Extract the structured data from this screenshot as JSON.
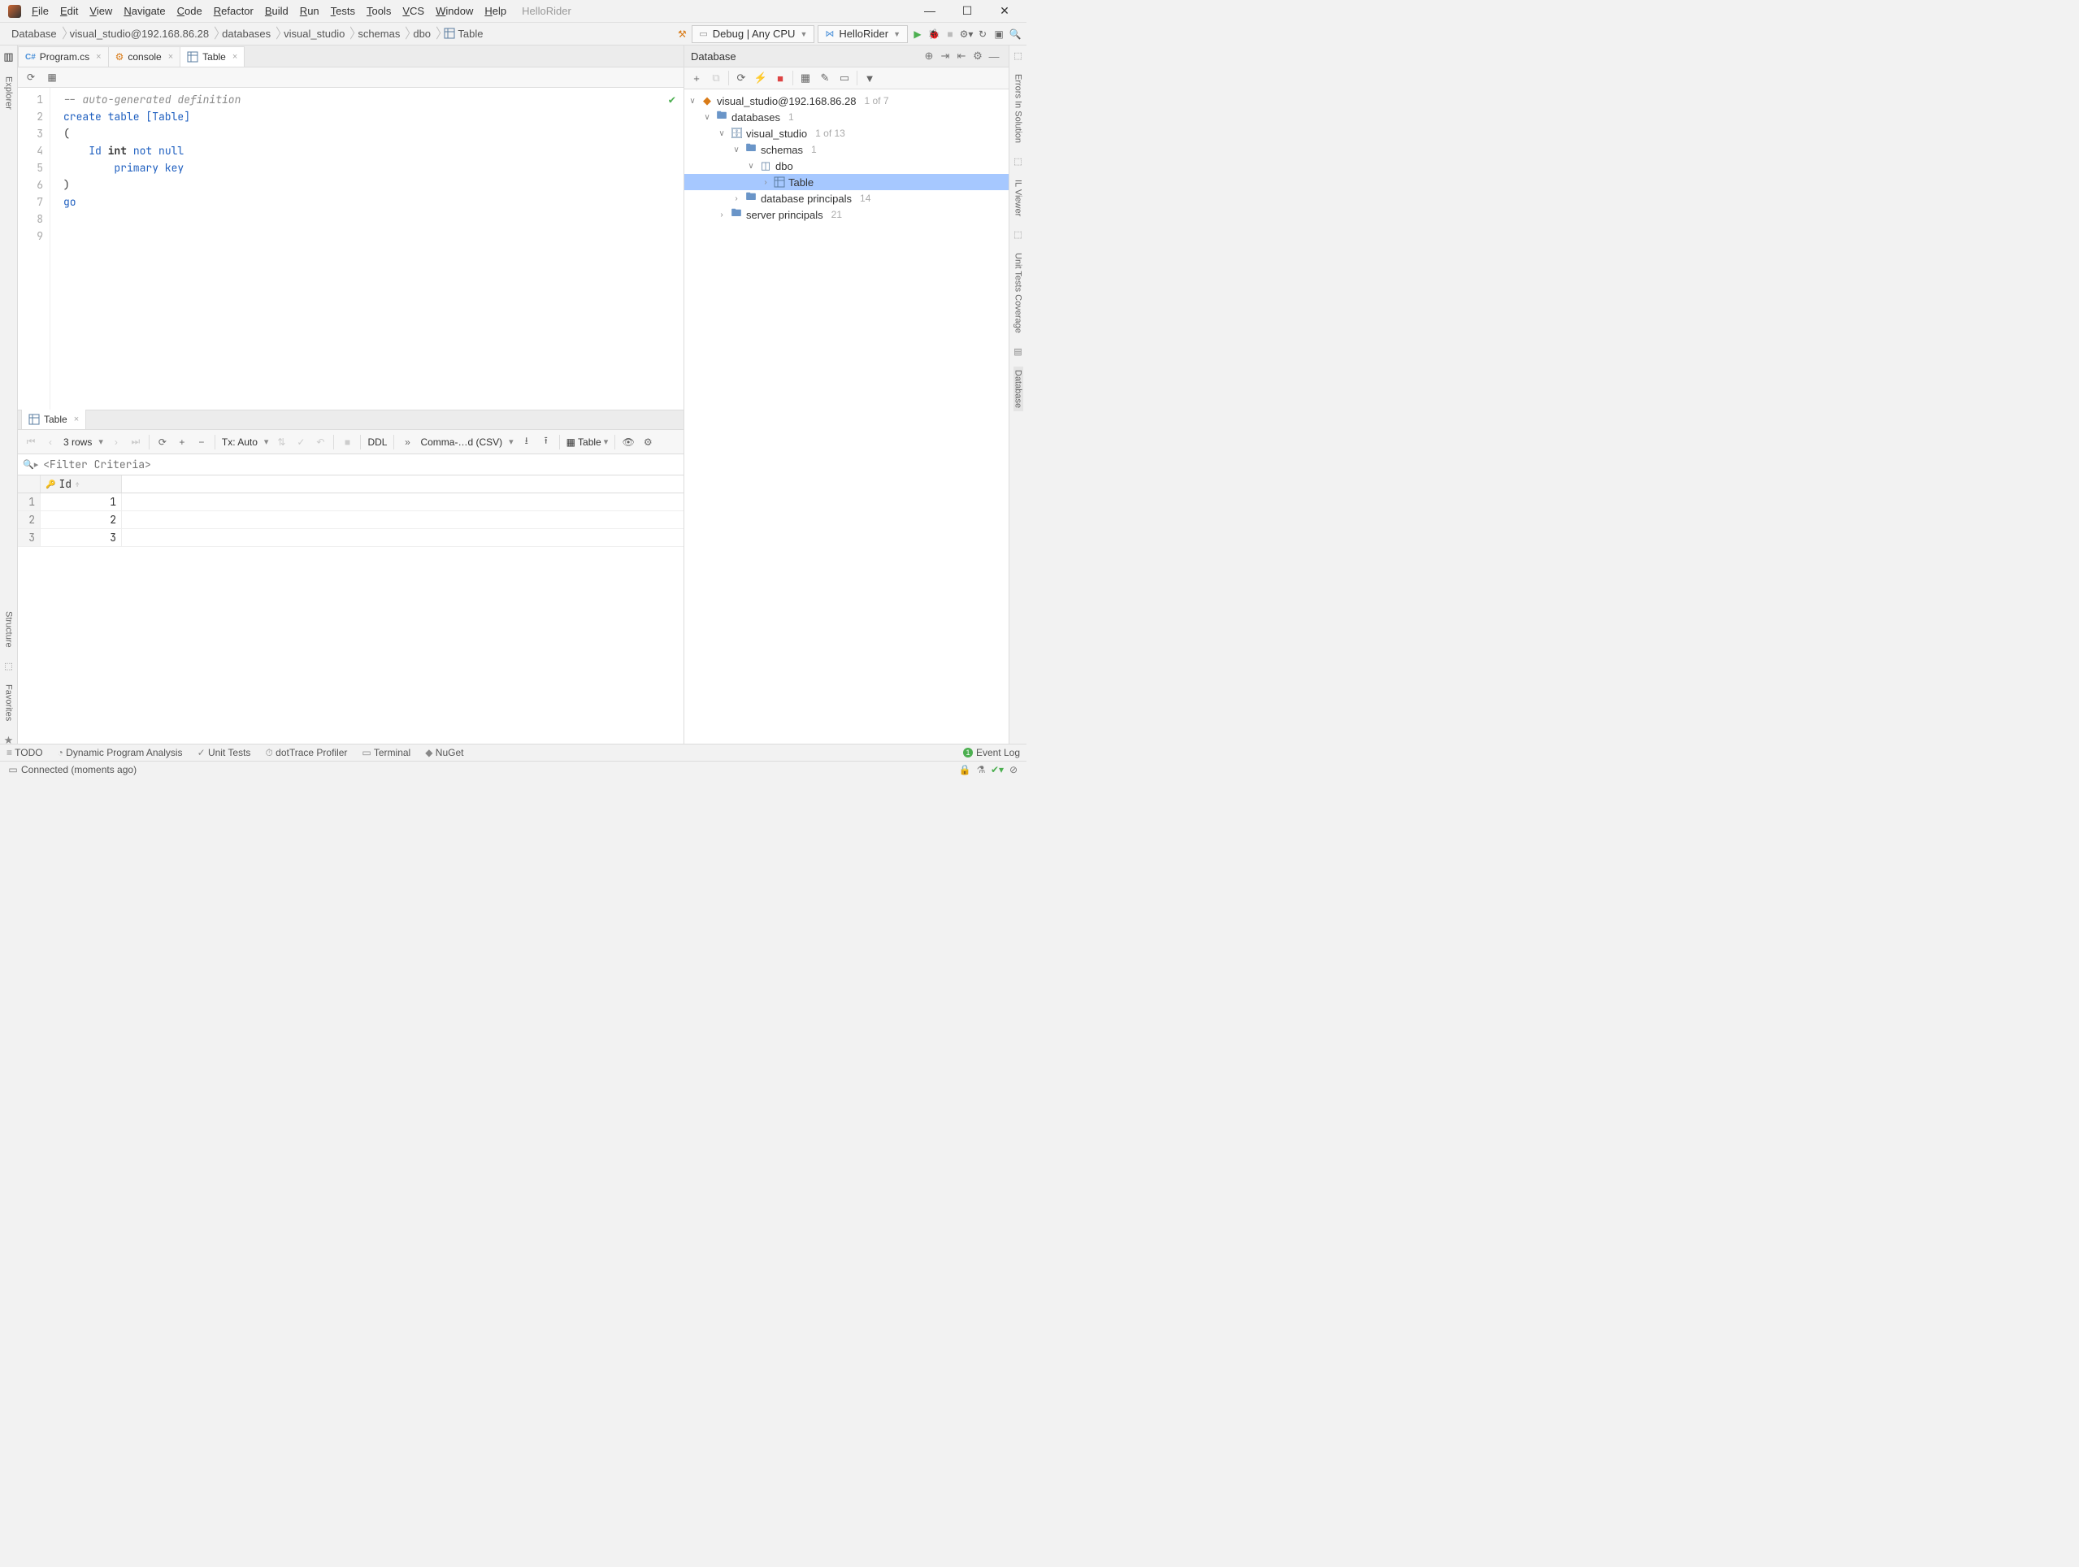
{
  "menu": {
    "items": [
      "File",
      "Edit",
      "View",
      "Navigate",
      "Code",
      "Refactor",
      "Build",
      "Run",
      "Tests",
      "Tools",
      "VCS",
      "Window",
      "Help"
    ],
    "project": "HelloRider"
  },
  "breadcrumb": [
    "Database",
    "visual_studio@192.168.86.28",
    "databases",
    "visual_studio",
    "schemas",
    "dbo",
    "Table"
  ],
  "run_config": "Debug | Any CPU",
  "project_combo": "HelloRider",
  "editor_tabs": [
    {
      "label": "Program.cs",
      "type": "cs"
    },
    {
      "label": "console",
      "type": "console"
    },
    {
      "label": "Table",
      "type": "table",
      "active": true
    }
  ],
  "code": {
    "lines": [
      {
        "n": 1,
        "seg": [
          {
            "t": "-- auto-generated definition",
            "cls": "c-comment"
          }
        ]
      },
      {
        "n": 2,
        "seg": [
          {
            "t": "create table ",
            "cls": "c-kw"
          },
          {
            "t": "[Table]",
            "cls": "c-brack"
          }
        ]
      },
      {
        "n": 3,
        "seg": [
          {
            "t": "(",
            "cls": "c-punc"
          }
        ]
      },
      {
        "n": 4,
        "seg": [
          {
            "t": "    Id ",
            "cls": "c-id"
          },
          {
            "t": "int",
            "cls": "c-type"
          },
          {
            "t": " not null",
            "cls": "c-kw"
          }
        ]
      },
      {
        "n": 5,
        "seg": [
          {
            "t": "        primary key",
            "cls": "c-kw"
          }
        ]
      },
      {
        "n": 6,
        "seg": [
          {
            "t": ")",
            "cls": "c-punc"
          }
        ]
      },
      {
        "n": 7,
        "seg": [
          {
            "t": "go",
            "cls": "c-kw"
          }
        ]
      },
      {
        "n": 8,
        "seg": []
      },
      {
        "n": 9,
        "seg": []
      }
    ]
  },
  "data_tab": {
    "label": "Table"
  },
  "data_toolbar": {
    "rows": "3 rows",
    "tx": "Tx: Auto",
    "ddl": "DDL",
    "csv": "Comma-…d (CSV)",
    "tablebtn": "Table"
  },
  "filter_placeholder": "<Filter Criteria>",
  "grid": {
    "column": "Id",
    "rows": [
      {
        "n": 1,
        "v": 1
      },
      {
        "n": 2,
        "v": 2
      },
      {
        "n": 3,
        "v": 3
      }
    ]
  },
  "db_panel": {
    "title": "Database"
  },
  "tree": {
    "root": {
      "label": "visual_studio@192.168.86.28",
      "count": "1 of 7"
    },
    "nodes": [
      {
        "indent": 1,
        "exp": "v",
        "icon": "folder",
        "label": "databases",
        "count": "1"
      },
      {
        "indent": 2,
        "exp": "v",
        "icon": "db",
        "label": "visual_studio",
        "count": "1 of 13"
      },
      {
        "indent": 3,
        "exp": "v",
        "icon": "folder",
        "label": "schemas",
        "count": "1"
      },
      {
        "indent": 4,
        "exp": "v",
        "icon": "schema",
        "label": "dbo",
        "count": ""
      },
      {
        "indent": 5,
        "exp": ">",
        "icon": "table",
        "label": "Table",
        "count": "",
        "selected": true
      },
      {
        "indent": 3,
        "exp": ">",
        "icon": "folder",
        "label": "database principals",
        "count": "14"
      },
      {
        "indent": 2,
        "exp": ">",
        "icon": "folder",
        "label": "server principals",
        "count": "21"
      }
    ]
  },
  "bottom_tools": [
    "TODO",
    "Dynamic Program Analysis",
    "Unit Tests",
    "dotTrace Profiler",
    "Terminal",
    "NuGet"
  ],
  "event_log": "Event Log",
  "status": "Connected (moments ago)",
  "left_gutter": [
    "Explorer"
  ],
  "right_gutter": [
    "Errors In Solution",
    "IL Viewer",
    "Unit Tests Coverage",
    "Database"
  ],
  "left_bottom": [
    "Structure",
    "Favorites"
  ]
}
